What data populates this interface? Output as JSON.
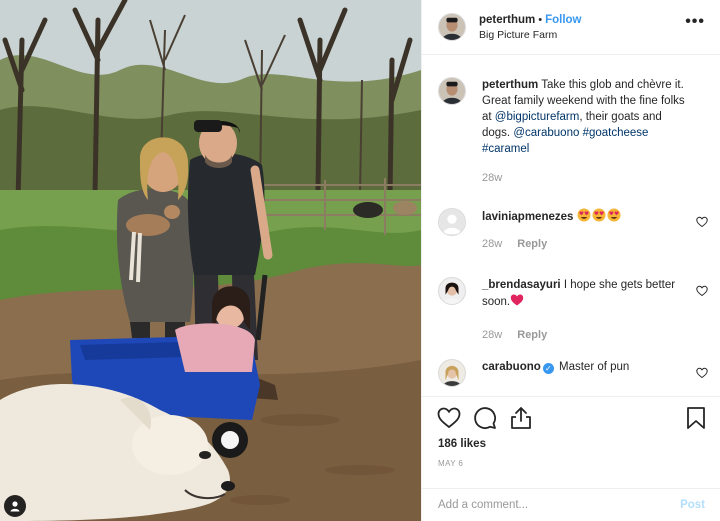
{
  "header": {
    "username": "peterthum",
    "separator": "•",
    "follow_label": "Follow",
    "location": "Big Picture Farm",
    "more_label": "•••"
  },
  "caption": {
    "username": "peterthum",
    "text_1": "Take this glob and chèvre it.",
    "text_2": "Great family weekend with the fine folks at",
    "mention_1": "@bigpicturefarm",
    "text_3": ", their goats and dogs.",
    "mention_2": "@carabuono",
    "hashtag_1": "#goatcheese",
    "hashtag_2": "#caramel",
    "time": "28w"
  },
  "comments": [
    {
      "username": "laviniapmenezes",
      "text": "",
      "emoji": [
        "heart-eyes",
        "heart-eyes",
        "heart-eyes"
      ],
      "time": "28w",
      "reply": "Reply"
    },
    {
      "username": "_brendasayuri",
      "text": "I hope she gets better soon.",
      "emoji": [
        "red-heart"
      ],
      "time": "28w",
      "reply": "Reply"
    },
    {
      "username": "carabuono",
      "verified": true,
      "text": "Master of pun"
    }
  ],
  "actions": {
    "likes": "186 likes",
    "date": "MAY 6"
  },
  "add_comment": {
    "placeholder": "Add a comment...",
    "post_label": "Post"
  },
  "colors": {
    "link": "#003569",
    "follow": "#3897f0",
    "muted": "#999999",
    "border": "#efefef",
    "post_disabled": "#b2dffc"
  },
  "icons": [
    "user-tag-icon",
    "more-options-icon",
    "heart-icon",
    "comment-icon",
    "share-icon",
    "bookmark-icon",
    "verified-badge-icon",
    "heart-eyes-emoji",
    "red-heart-emoji"
  ]
}
